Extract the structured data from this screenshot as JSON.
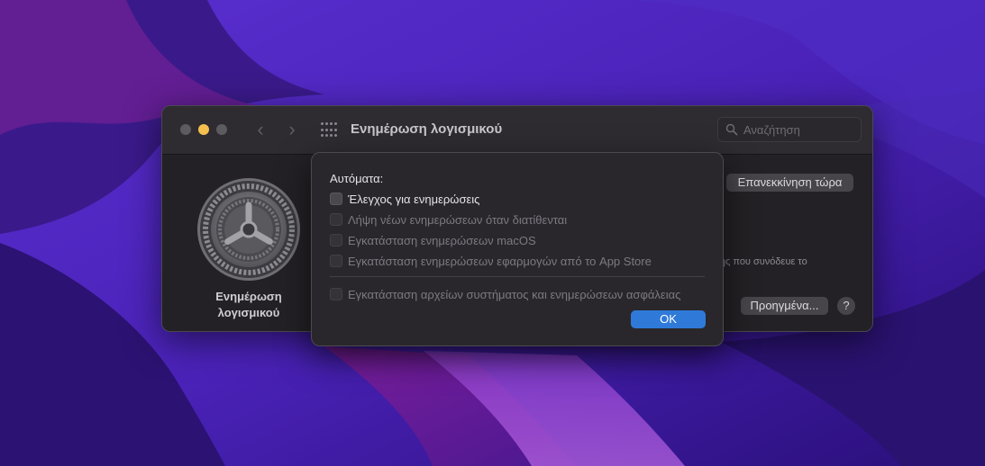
{
  "window": {
    "title": "Ενημέρωση λογισμικού",
    "back_glyph": "‹",
    "forward_glyph": "›",
    "search_placeholder": "Αναζήτηση"
  },
  "pane": {
    "label": "Ενημέρωση λογισμικού",
    "icon": "gear-icon",
    "restart_label": "Επανεκκίνηση τώρα",
    "status_text": "ήσης που συνόδευε το",
    "advanced_label": "Προηγμένα...",
    "help_label": "?"
  },
  "sheet": {
    "heading": "Αυτόματα:",
    "options": [
      {
        "label": "Έλεγχος για ενημερώσεις",
        "checked": false,
        "enabled": true
      },
      {
        "label": "Λήψη νέων ενημερώσεων όταν διατίθενται",
        "checked": false,
        "enabled": false
      },
      {
        "label": "Εγκατάσταση ενημερώσεων macOS",
        "checked": false,
        "enabled": false
      },
      {
        "label": "Εγκατάσταση ενημερώσεων εφαρμογών από το App Store",
        "checked": false,
        "enabled": false
      },
      {
        "label": "Εγκατάσταση αρχείων συστήματος και ενημερώσεων ασφάλειας",
        "checked": false,
        "enabled": false
      }
    ],
    "ok_label": "OK"
  },
  "colors": {
    "accent": "#2f7ad9",
    "minimize": "#f5bf4f",
    "window_bg": "#242226"
  }
}
